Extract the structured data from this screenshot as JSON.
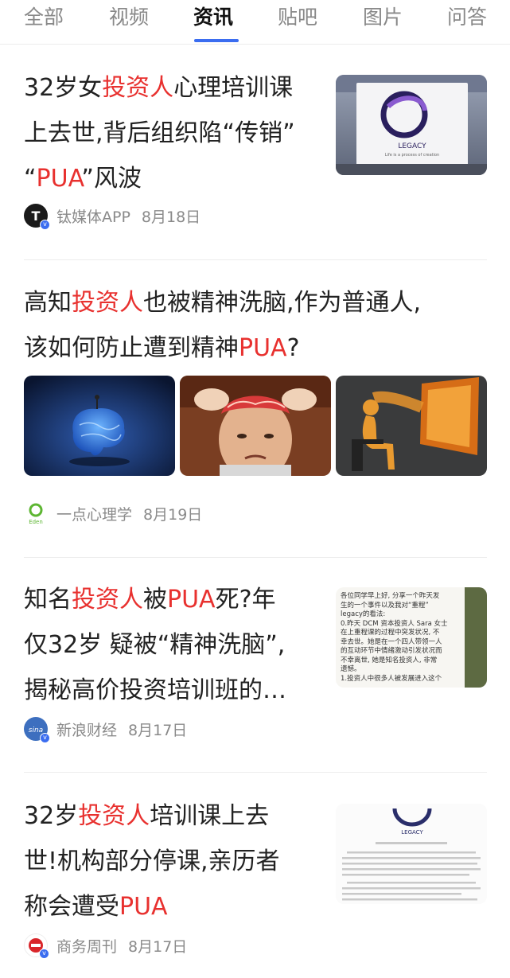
{
  "tabs": [
    {
      "label": "全部"
    },
    {
      "label": "视频"
    },
    {
      "label": "资讯"
    },
    {
      "label": "贴吧"
    },
    {
      "label": "图片"
    },
    {
      "label": "问答"
    }
  ],
  "active_tab": "资讯",
  "colors": {
    "highlight": "#e8312f",
    "accent": "#3b6df0"
  },
  "articles": [
    {
      "title_parts": {
        "l1a": "32岁女",
        "l1b": "投资人",
        "l1c": "心理培训课",
        "l2a": "上去世,背后组织陷“传销”",
        "l3a": "“",
        "l3b": "PUA",
        "l3c": "”风波"
      },
      "source": "钛媒体APP",
      "date": "8月18日",
      "source_icon": "tmtpost-logo-icon",
      "thumb_logo_text": "LEGACY",
      "thumb_logo_subtext": "Life is a process of creation"
    },
    {
      "title_parts": {
        "l1a": "高知",
        "l1b": "投资人",
        "l1c": "也被精神洗脑,作为普通人,",
        "l2a": "该如何防止遭到精神",
        "l2b": "PUA",
        "l2c": "?"
      },
      "source": "一点心理学",
      "date": "8月19日",
      "source_icon": "eden-logo-icon",
      "source_icon_text": "Eden"
    },
    {
      "title_parts": {
        "l1a": "知名",
        "l1b": "投资人",
        "l1c": "被",
        "l1d": "PUA",
        "l1e": "死?年",
        "l2a": "仅32岁 疑被“精神洗脑”,",
        "l3a": "揭秘高价投资培训班的…"
      },
      "source": "新浪财经",
      "date": "8月17日",
      "source_icon": "sina-logo-icon",
      "source_icon_text": "sina",
      "thumb_text": [
        "各位同学早上好, 分享一个昨天发",
        "生的一个事件以及我对“重程”",
        "legacy的看法:",
        "0.昨天 DCM 资本投资人 Sara 女士",
        "在上重程课的过程中突发状况, 不",
        "幸去世。她是在一个四人带领一人",
        "的互动环节中情绪激动引发状况而",
        "不幸离世, 她是知名投资人, 非常",
        "遗憾。",
        "1.投资人中很多人被发展进入这个"
      ]
    },
    {
      "title_parts": {
        "l1a": "32岁",
        "l1b": "投资人",
        "l1c": "培训课上去",
        "l2a": "世!机构部分停课,亲历者",
        "l3a": "称会遭受",
        "l3b": "PUA"
      },
      "source": "商务周刊",
      "date": "8月17日",
      "source_icon": "business-weekly-logo-icon",
      "thumb_logo_text": "LEGACY"
    }
  ]
}
